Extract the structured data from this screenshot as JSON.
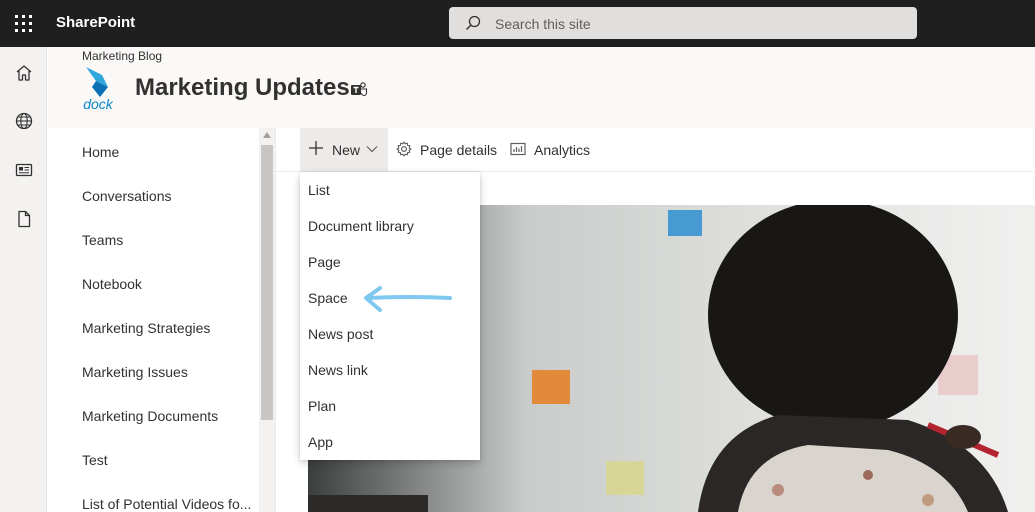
{
  "suite_bar": {
    "app_name": "SharePoint",
    "search_placeholder": "Search this site",
    "icons": [
      "app-launcher-icon",
      "search-icon"
    ]
  },
  "app_bar": {
    "icons": [
      "home-icon",
      "globe-icon",
      "news-icon",
      "document-icon"
    ]
  },
  "site_header": {
    "hub_name": "Marketing Blog",
    "logo_text": "dock",
    "title": "Marketing Updates",
    "teams_icon": "teams-icon"
  },
  "left_nav": {
    "items": [
      {
        "label": "Home"
      },
      {
        "label": "Conversations"
      },
      {
        "label": "Teams"
      },
      {
        "label": "Notebook"
      },
      {
        "label": "Marketing Strategies"
      },
      {
        "label": "Marketing Issues"
      },
      {
        "label": "Marketing Documents"
      },
      {
        "label": "Test"
      },
      {
        "label": "List of Potential Videos fo..."
      }
    ]
  },
  "command_bar": {
    "new_label": "New",
    "page_details_label": "Page details",
    "analytics_label": "Analytics"
  },
  "new_menu": {
    "items": [
      {
        "label": "List"
      },
      {
        "label": "Document library"
      },
      {
        "label": "Page"
      },
      {
        "label": "Space"
      },
      {
        "label": "News post"
      },
      {
        "label": "News link"
      },
      {
        "label": "Plan"
      },
      {
        "label": "App"
      }
    ]
  },
  "colors": {
    "suite_bar": "#1f1f1f",
    "annotation_arrow": "#7fc8f0",
    "logo_blue": "#0a86c9"
  }
}
